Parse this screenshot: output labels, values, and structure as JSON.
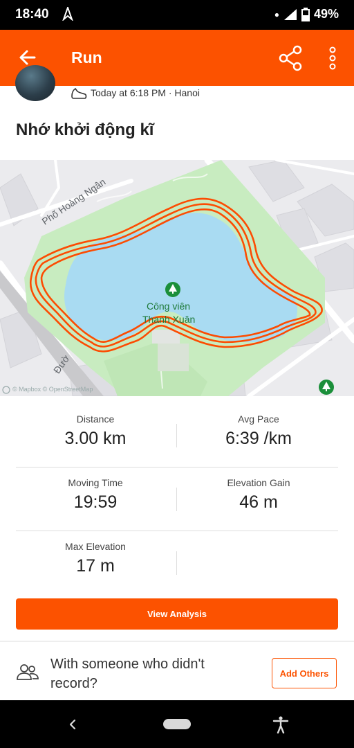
{
  "status_bar": {
    "time": "18:40",
    "battery": "49%",
    "icons": [
      "navigation-icon",
      "dot-icon",
      "signal-icon",
      "battery-icon"
    ]
  },
  "app_bar": {
    "title": "Run",
    "color": "#fc5200",
    "icons": [
      "back-arrow-icon",
      "share-icon",
      "more-vert-icon"
    ]
  },
  "activity": {
    "meta": "Today at 6:18 PM · Hanoi",
    "title": "Nhớ khởi động kĩ"
  },
  "map": {
    "street_labels": [
      "Phố Hoàng Ngân",
      "Đườ"
    ],
    "park_name_line1": "Công viên",
    "park_name_line2": "Thanh Xuân",
    "attribution": "© Mapbox © OpenStreetMap",
    "route_color": "#fc4c02"
  },
  "stats": [
    {
      "label": "Distance",
      "value": "3.00 km"
    },
    {
      "label": "Avg Pace",
      "value": "6:39 /km"
    },
    {
      "label": "Moving Time",
      "value": "19:59"
    },
    {
      "label": "Elevation Gain",
      "value": "46 m"
    },
    {
      "label": "Max Elevation",
      "value": "17 m"
    }
  ],
  "view_analysis_label": "View Analysis",
  "others": {
    "text": "With someone who didn't record?",
    "button_label": "Add Others"
  }
}
